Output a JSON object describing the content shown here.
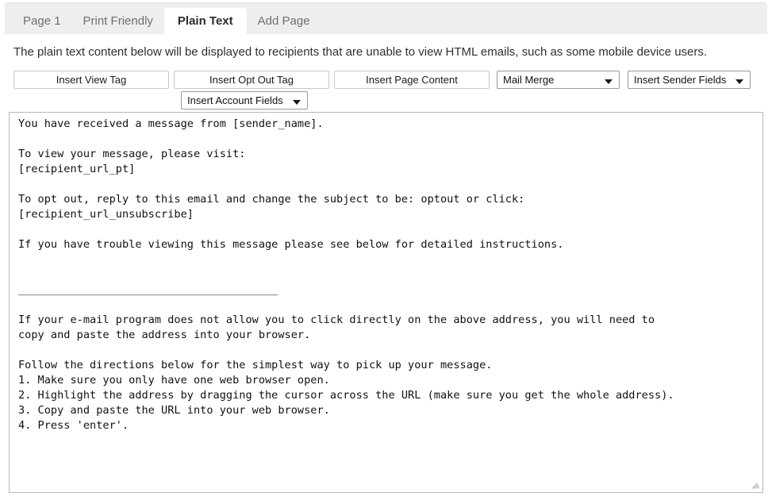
{
  "tabs": [
    {
      "label": "Page 1",
      "active": false
    },
    {
      "label": "Print Friendly",
      "active": false
    },
    {
      "label": "Plain Text",
      "active": true
    },
    {
      "label": "Add Page",
      "active": false
    }
  ],
  "description": "The plain text content below will be displayed to recipients that are unable to view HTML emails, such as some mobile device users.",
  "toolbar": {
    "insert_view_tag": "Insert View Tag",
    "insert_opt_out_tag": "Insert Opt Out Tag",
    "insert_page_content": "Insert Page Content",
    "mail_merge": "Mail Merge",
    "insert_sender_fields": "Insert Sender Fields",
    "insert_account_fields": "Insert Account Fields",
    "caret_icon": "chevron-down-icon"
  },
  "editor": {
    "content": "You have received a message from [sender_name].\n\nTo view your message, please visit:\n[recipient_url_pt]\n\nTo opt out, reply to this email and change the subject to be: optout or click:\n[recipient_url_unsubscribe]\n\nIf you have trouble viewing this message please see below for detailed instructions.\n\n\n________________________________________\n\nIf your e-mail program does not allow you to click directly on the above address, you will need to\ncopy and paste the address into your browser.\n\nFollow the directions below for the simplest way to pick up your message.\n1. Make sure you only have one web browser open.\n2. Highlight the address by dragging the cursor across the URL (make sure you get the whole address).\n3. Copy and paste the URL into your web browser.\n4. Press 'enter'.",
    "placeholder": "",
    "resize_grip_icon": "resize-grip-icon"
  },
  "colors": {
    "tabbar_bg": "#eeeeee",
    "active_tab_bg": "#ffffff",
    "page_bg": "#ffffff",
    "border": "#b9b9b9",
    "text": "#111111"
  }
}
